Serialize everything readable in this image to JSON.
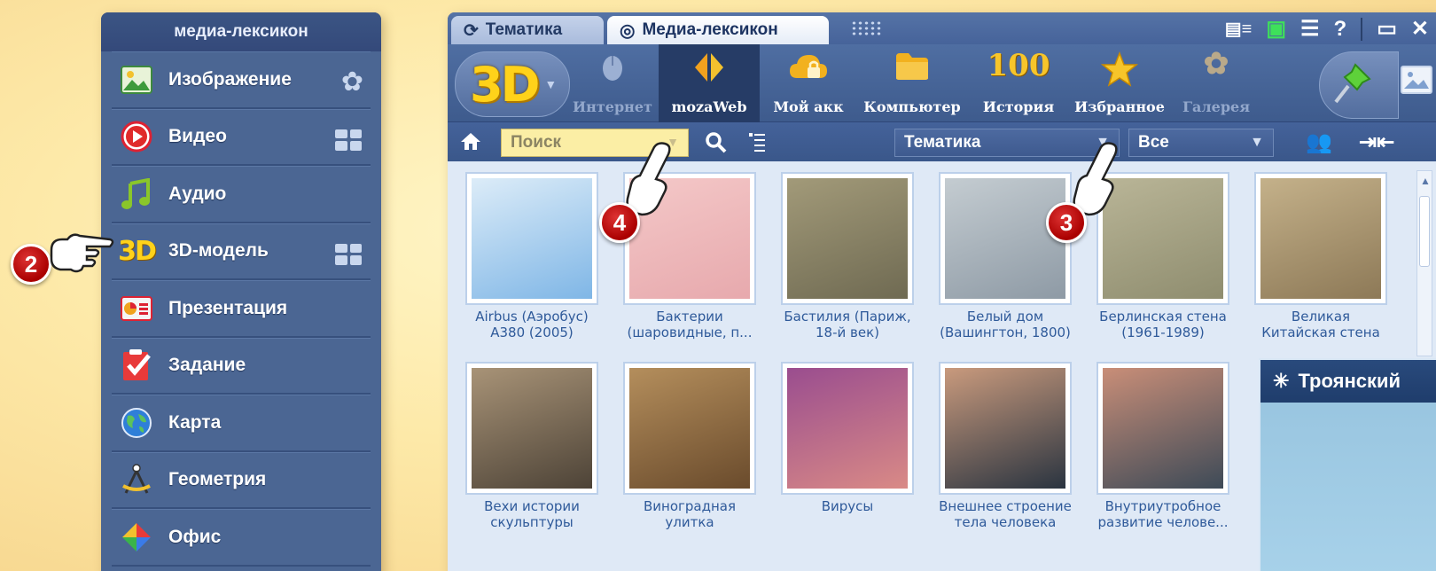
{
  "left_panel": {
    "title": "медиа-лексикон",
    "items": [
      {
        "label": "Изображение",
        "icon": "image-icon",
        "extra": "flower-icon"
      },
      {
        "label": "Видео",
        "icon": "video-icon",
        "extra": "grid-icon"
      },
      {
        "label": "Аудио",
        "icon": "music-note-icon",
        "extra": ""
      },
      {
        "label": "3D-модель",
        "icon": "3d-icon",
        "extra": "grid-icon"
      },
      {
        "label": "Презентация",
        "icon": "presentation-icon",
        "extra": ""
      },
      {
        "label": "Задание",
        "icon": "task-check-icon",
        "extra": ""
      },
      {
        "label": "Карта",
        "icon": "globe-icon",
        "extra": ""
      },
      {
        "label": "Геометрия",
        "icon": "compass-icon",
        "extra": ""
      },
      {
        "label": "Офис",
        "icon": "office-diamond-icon",
        "extra": ""
      }
    ]
  },
  "badges": {
    "two": "2",
    "three": "3",
    "four": "4"
  },
  "window": {
    "tabs": [
      {
        "label": "Тематика",
        "active": false
      },
      {
        "label": "Медиа-лексикон",
        "active": true
      }
    ],
    "logo": "3D",
    "toolbar": [
      {
        "label": "Интернет",
        "icon": "mouse-icon",
        "dim": true
      },
      {
        "label": "mozaWeb",
        "icon": "mozaweb-diamond-icon",
        "dim": false,
        "selected": true
      },
      {
        "label": "Мой акк",
        "icon": "cloud-lock-icon",
        "dim": false
      },
      {
        "label": "Компьютер",
        "icon": "folder-icon",
        "dim": false
      },
      {
        "label": "История",
        "icon": "history-100-icon",
        "dim": false,
        "icon_text": "100"
      },
      {
        "label": "Избранное",
        "icon": "star-icon",
        "dim": false
      },
      {
        "label": "Галерея",
        "icon": "gallery-flower-icon",
        "dim": true
      }
    ],
    "search": {
      "placeholder": "Поиск",
      "topic_select": "Тематика",
      "filter_select": "Все"
    },
    "thumbnails_row1": [
      {
        "caption1": "Airbus (Аэробус)",
        "caption2": "A380 (2005)",
        "colors": [
          "#7fb6e6",
          "#dcecf8"
        ]
      },
      {
        "caption1": "Бактерии",
        "caption2": "(шаровидные, п...",
        "colors": [
          "#e7a9ad",
          "#f4c8c8"
        ]
      },
      {
        "caption1": "Бастилия (Париж,",
        "caption2": "18-й век)",
        "colors": [
          "#6f6a52",
          "#a29a79"
        ]
      },
      {
        "caption1": "Белый дом",
        "caption2": "(Вашингтон, 1800)",
        "colors": [
          "#8e9aa5",
          "#c4ccd1"
        ]
      },
      {
        "caption1": "Берлинская стена",
        "caption2": "(1961-1989)",
        "colors": [
          "#8f8d6f",
          "#b9b597"
        ]
      },
      {
        "caption1": "Великая",
        "caption2": "Китайская стена",
        "colors": [
          "#8d7957",
          "#c4b18a"
        ]
      }
    ],
    "thumbnails_row2": [
      {
        "caption1": "Вехи истории",
        "caption2": "скульптуры",
        "colors": [
          "#4d4337",
          "#a89377"
        ]
      },
      {
        "caption1": "Виноградная",
        "caption2": "улитка",
        "colors": [
          "#6a4b2c",
          "#b48e5c"
        ]
      },
      {
        "caption1": "Вирусы",
        "caption2": "",
        "colors": [
          "#d98a86",
          "#9a4d8f"
        ]
      },
      {
        "caption1": "Внешнее строение",
        "caption2": "тела человека",
        "colors": [
          "#2a3440",
          "#c99a7d"
        ]
      },
      {
        "caption1": "Внутриутробное",
        "caption2": "развитие челове...",
        "colors": [
          "#3d4a57",
          "#c98e78"
        ]
      }
    ],
    "popup_title": "Троянский"
  }
}
